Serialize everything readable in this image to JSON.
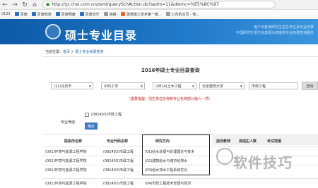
{
  "browser": {
    "url": "http://yz.chsi.com.cn/zsml/querySchAction.do?ssdm=11&dwmc=%E5%8C%97",
    "bookmarks": [
      "0123",
      "百度",
      "百度知道",
      "百度网盘",
      "百度音乐",
      "链接",
      "建筑施工技术第一版...",
      "公司的主页 - 和..."
    ]
  },
  "header": {
    "title": "硕士专业目录",
    "org_line1": "用户可查询研究生招生单位及专业目录",
    "org_line2": "中国研究生招生信息网为您提供专业目录查询服务"
  },
  "breadcrumb": {
    "prefix": "当前位置：",
    "home": "首页",
    "sep": " > ",
    "current": "硕士专业目录查询"
  },
  "query": {
    "title": "2016年硕士专业目录查询",
    "region": "(11)北京市",
    "category": "(08)工学",
    "discipline": "(0814)土木工程",
    "school": "北京建筑大学",
    "major_input": "市政工程",
    "search_label": "查询",
    "notice": "（重要提醒：招生单位名称和专业名称部分输入一项）"
  },
  "filter": {
    "label": "专业筛选：",
    "option": "(081403)市政工程",
    "confirm": "确定"
  },
  "table": {
    "headers": [
      "院系所名称",
      "专业代码名称",
      "研究方向",
      "指导教师",
      "拟招生人数",
      "考试范围"
    ],
    "rows": [
      [
        "(001)环境与能源工程学院",
        "(081403)市政工程",
        "(01)给水处理与处理理论与技术"
      ],
      [
        "(001)环境与能源工程学院",
        "(081403)市政工程",
        "(02)建筑给水与城市给排水"
      ],
      [
        "(001)环境与能源工程学院",
        "(081403)市政工程",
        "(03)给水排水工程系统优化"
      ],
      [
        "(001)环境与能源工程学院",
        "(081403)市政工程",
        "(04)市政工程技术管理与经济"
      ]
    ]
  },
  "watermark": "软件技巧",
  "colors": {
    "header_blue": "#0d5aa7",
    "accent_red": "#c01e1e",
    "button_blue": "#3d78c4"
  }
}
